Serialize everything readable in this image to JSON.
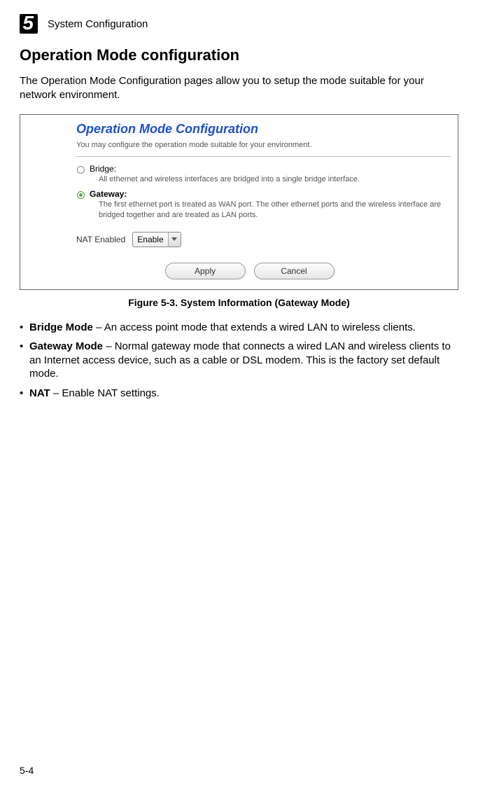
{
  "header": {
    "chapter_number": "5",
    "chapter_title": "System Configuration"
  },
  "section": {
    "title": "Operation Mode configuration",
    "intro": "The Operation Mode Configuration pages allow you to setup the mode suitable for your network environment."
  },
  "screenshot": {
    "title": "Operation Mode Configuration",
    "subtitle": "You may configure the operation mode suitable for your environment.",
    "bridge": {
      "label": "Bridge:",
      "desc": "All ethernet and wireless interfaces are bridged into a single bridge interface."
    },
    "gateway": {
      "label": "Gateway:",
      "desc": "The first ethernet port is treated as WAN port. The other ethernet ports and the wireless interface are bridged together and are treated as LAN ports."
    },
    "nat": {
      "label": "NAT Enabled",
      "value": "Enable"
    },
    "buttons": {
      "apply": "Apply",
      "cancel": "Cancel"
    }
  },
  "figure_caption": "Figure 5-3.   System Information (Gateway Mode)",
  "definitions": {
    "bridge": {
      "term": "Bridge Mode",
      "text": " – An access point mode that extends a wired LAN to wireless clients."
    },
    "gateway": {
      "term": "Gateway Mode",
      "text": " – Normal gateway mode that connects a wired LAN and wireless clients to an Internet access device, such as a cable or DSL modem. This is the factory set default mode."
    },
    "nat": {
      "term": "NAT",
      "text": " – Enable NAT settings."
    }
  },
  "page_number": "5-4"
}
